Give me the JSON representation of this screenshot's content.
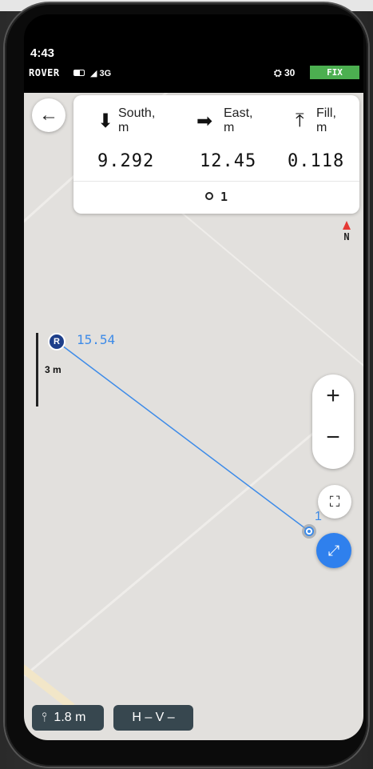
{
  "status": {
    "time": "4:43",
    "mode": "ROVER",
    "network": "3G",
    "satellites": "30",
    "fix": "FIX"
  },
  "stakeout": {
    "south_label": "South,\nm",
    "east_label": "East,\nm",
    "fill_label": "Fill,\nm",
    "south_value": "9.292",
    "east_value": "12.45",
    "fill_value": "0.118",
    "point_name": "1"
  },
  "map": {
    "compass": "N",
    "scale": "3 m",
    "base_label": "R",
    "base_distance": "15.54",
    "target_label": "1",
    "line_color": "#3d8be8"
  },
  "bottom": {
    "pole_height": "1.8 m",
    "accuracy": "H –  V –"
  },
  "colors": {
    "fix": "#4caf50",
    "accent": "#2f80ed",
    "pill": "#37474f"
  },
  "icons": [
    "back-arrow-icon",
    "arrow-down-icon",
    "arrow-right-icon",
    "arrow-up-bar-icon",
    "plus-icon",
    "minus-icon",
    "fullscreen-icon",
    "locate-icon",
    "pole-icon",
    "satellite-icon",
    "battery-icon"
  ]
}
